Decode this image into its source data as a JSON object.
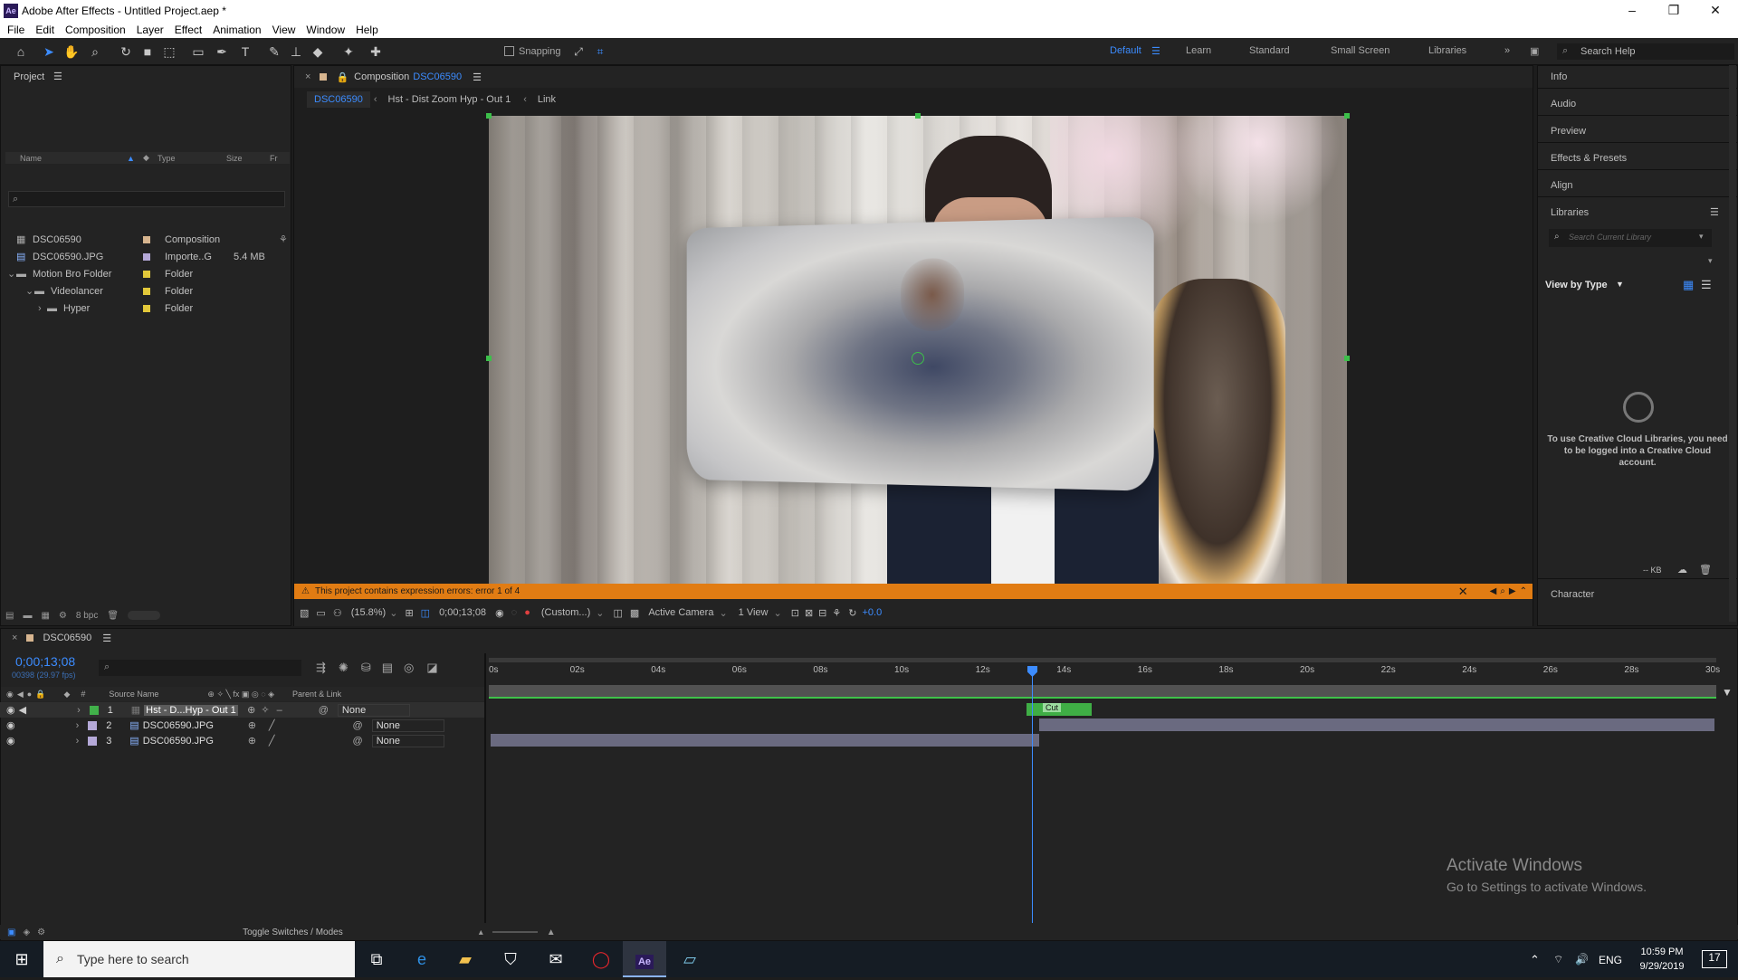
{
  "window": {
    "app_icon": "Ae",
    "title": "Adobe After Effects - Untitled Project.aep *"
  },
  "menu": [
    "File",
    "Edit",
    "Composition",
    "Layer",
    "Effect",
    "Animation",
    "View",
    "Window",
    "Help"
  ],
  "toolbar": {
    "snapping_label": "Snapping",
    "workspaces": [
      "Default",
      "Learn",
      "Standard",
      "Small Screen",
      "Libraries"
    ],
    "active_workspace": "Default",
    "search_help_placeholder": "Search Help"
  },
  "project_panel": {
    "title": "Project",
    "columns": {
      "name": "Name",
      "type": "Type",
      "size": "Size",
      "fr": "Fr"
    },
    "bpc": "8 bpc",
    "items": [
      {
        "name": "DSC06590",
        "type": "Composition",
        "size": "",
        "color": "#d7b58f",
        "icon": "composition-icon"
      },
      {
        "name": "DSC06590.JPG",
        "type": "Importe..G",
        "size": "5.4 MB",
        "color": "#b5a9d8",
        "icon": "image-icon"
      },
      {
        "name": "Motion Bro Folder",
        "type": "Folder",
        "size": "",
        "color": "#e2c83a",
        "icon": "folder-icon"
      },
      {
        "name": "Videolancer",
        "type": "Folder",
        "size": "",
        "color": "#e2c83a",
        "icon": "folder-icon"
      },
      {
        "name": "Hyper",
        "type": "Folder",
        "size": "",
        "color": "#e2c83a",
        "icon": "folder-icon"
      }
    ]
  },
  "composition": {
    "tab_prefix": "Composition",
    "tab_name": "DSC06590",
    "breadcrumbs": [
      "DSC06590",
      "Hst - Dist Zoom Hyp - Out 1",
      "Link"
    ],
    "error_text": "This project contains expression errors: error 1 of 4",
    "zoom": "(15.8%)",
    "timecode": "0;00;13;08",
    "resolution": "(Custom...)",
    "camera": "Active Camera",
    "views": "1 View",
    "exposure": "+0.0"
  },
  "right_panel": {
    "items": [
      "Info",
      "Audio",
      "Preview",
      "Effects & Presets",
      "Align",
      "Libraries"
    ],
    "search_placeholder": "Search Current Library",
    "view_by": "View by Type",
    "message": "To use Creative Cloud Libraries, you need to be logged into a Creative Cloud account.",
    "kb": "-- KB",
    "character": "Character"
  },
  "timeline": {
    "tab": "DSC06590",
    "timecode": "0;00;13;08",
    "frames": "00398 (29.97 fps)",
    "columns": {
      "num": "#",
      "source": "Source Name",
      "parent": "Parent & Link"
    },
    "ticks": [
      "0s",
      "02s",
      "04s",
      "06s",
      "08s",
      "10s",
      "12s",
      "14s",
      "16s",
      "18s",
      "20s",
      "22s",
      "24s",
      "26s",
      "28s",
      "30s"
    ],
    "layers": [
      {
        "num": "1",
        "name": "Hst - D...Hyp - Out 1",
        "parent": "None",
        "color": "#41b04a"
      },
      {
        "num": "2",
        "name": "DSC06590.JPG",
        "parent": "None",
        "color": "#b5a9d8"
      },
      {
        "num": "3",
        "name": "DSC06590.JPG",
        "parent": "None",
        "color": "#b5a9d8"
      }
    ],
    "cut_label": "Cut",
    "toggle_label": "Toggle Switches / Modes"
  },
  "watermark": {
    "line1": "Activate Windows",
    "line2": "Go to Settings to activate Windows."
  },
  "taskbar": {
    "search_placeholder": "Type here to search",
    "language": "ENG",
    "time": "10:59 PM",
    "date": "9/29/2019",
    "notifications": "17"
  }
}
